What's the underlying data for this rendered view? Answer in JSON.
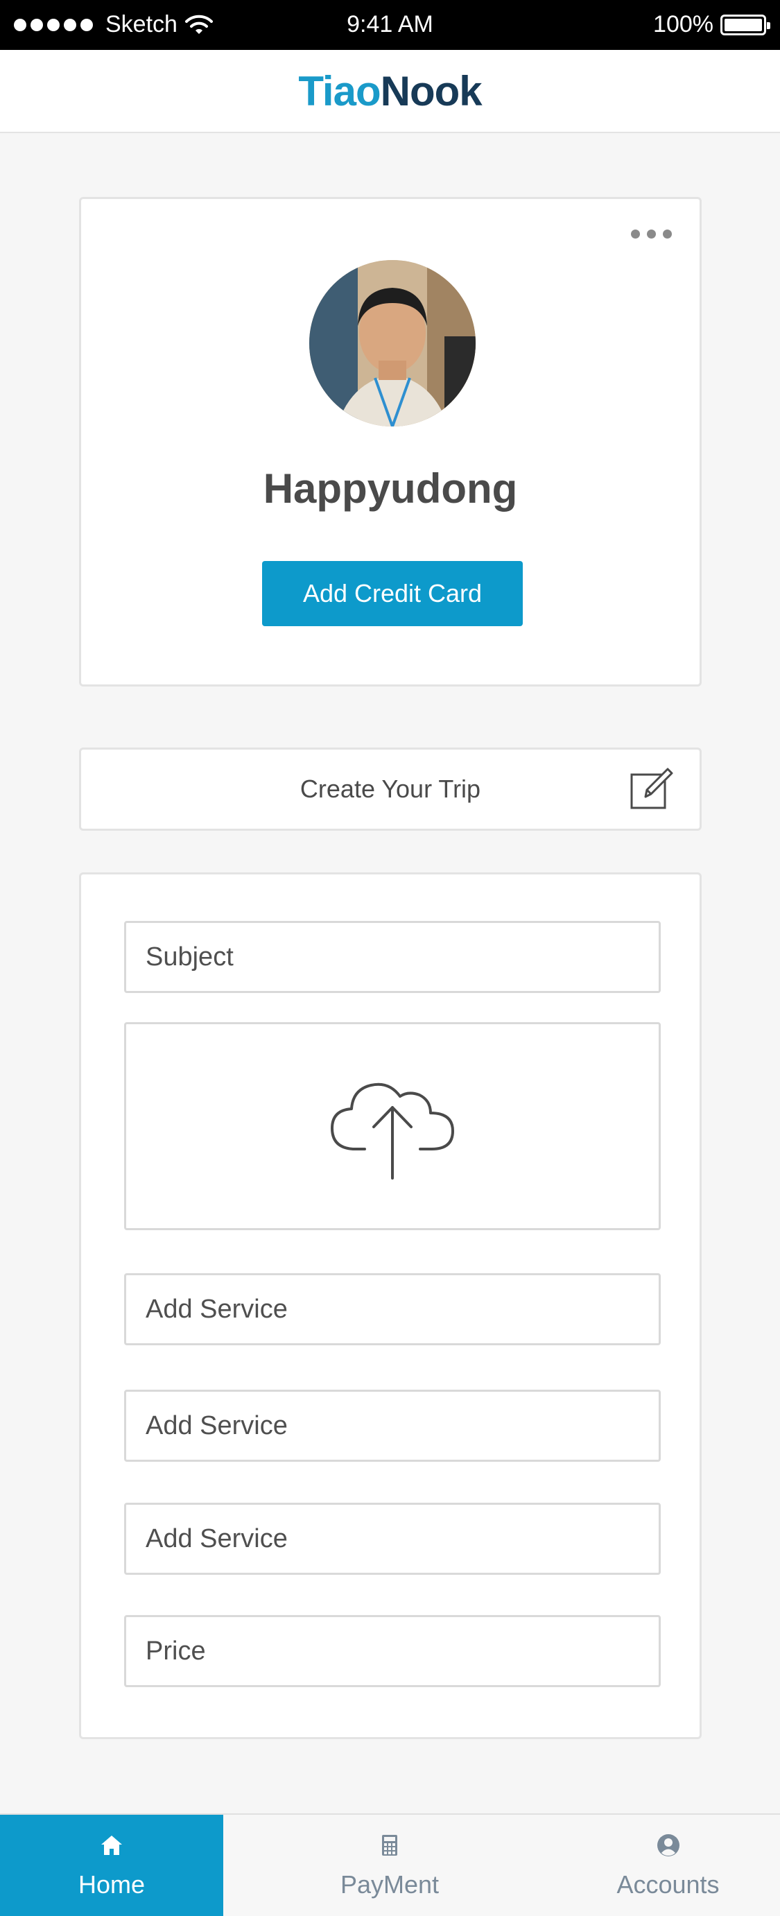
{
  "status_bar": {
    "carrier": "Sketch",
    "time": "9:41 AM",
    "battery": "100%"
  },
  "header": {
    "logo_part1": "Tiao",
    "logo_part2": "Nook"
  },
  "profile": {
    "name": "Happyudong",
    "add_card_label": "Add Credit Card"
  },
  "trip": {
    "label": "Create Your Trip"
  },
  "form": {
    "subject_placeholder": "Subject",
    "service1_placeholder": "Add Service",
    "service2_placeholder": "Add Service",
    "service3_placeholder": "Add Service",
    "price_placeholder": "Price"
  },
  "tabs": [
    {
      "label": "Home",
      "icon": "home-icon",
      "active": true
    },
    {
      "label": "PayMent",
      "icon": "calculator-icon",
      "active": false
    },
    {
      "label": "Accounts",
      "icon": "user-icon",
      "active": false
    }
  ],
  "colors": {
    "accent": "#0d9acb",
    "logo_light": "#1a9ac9",
    "logo_dark": "#173a57"
  }
}
